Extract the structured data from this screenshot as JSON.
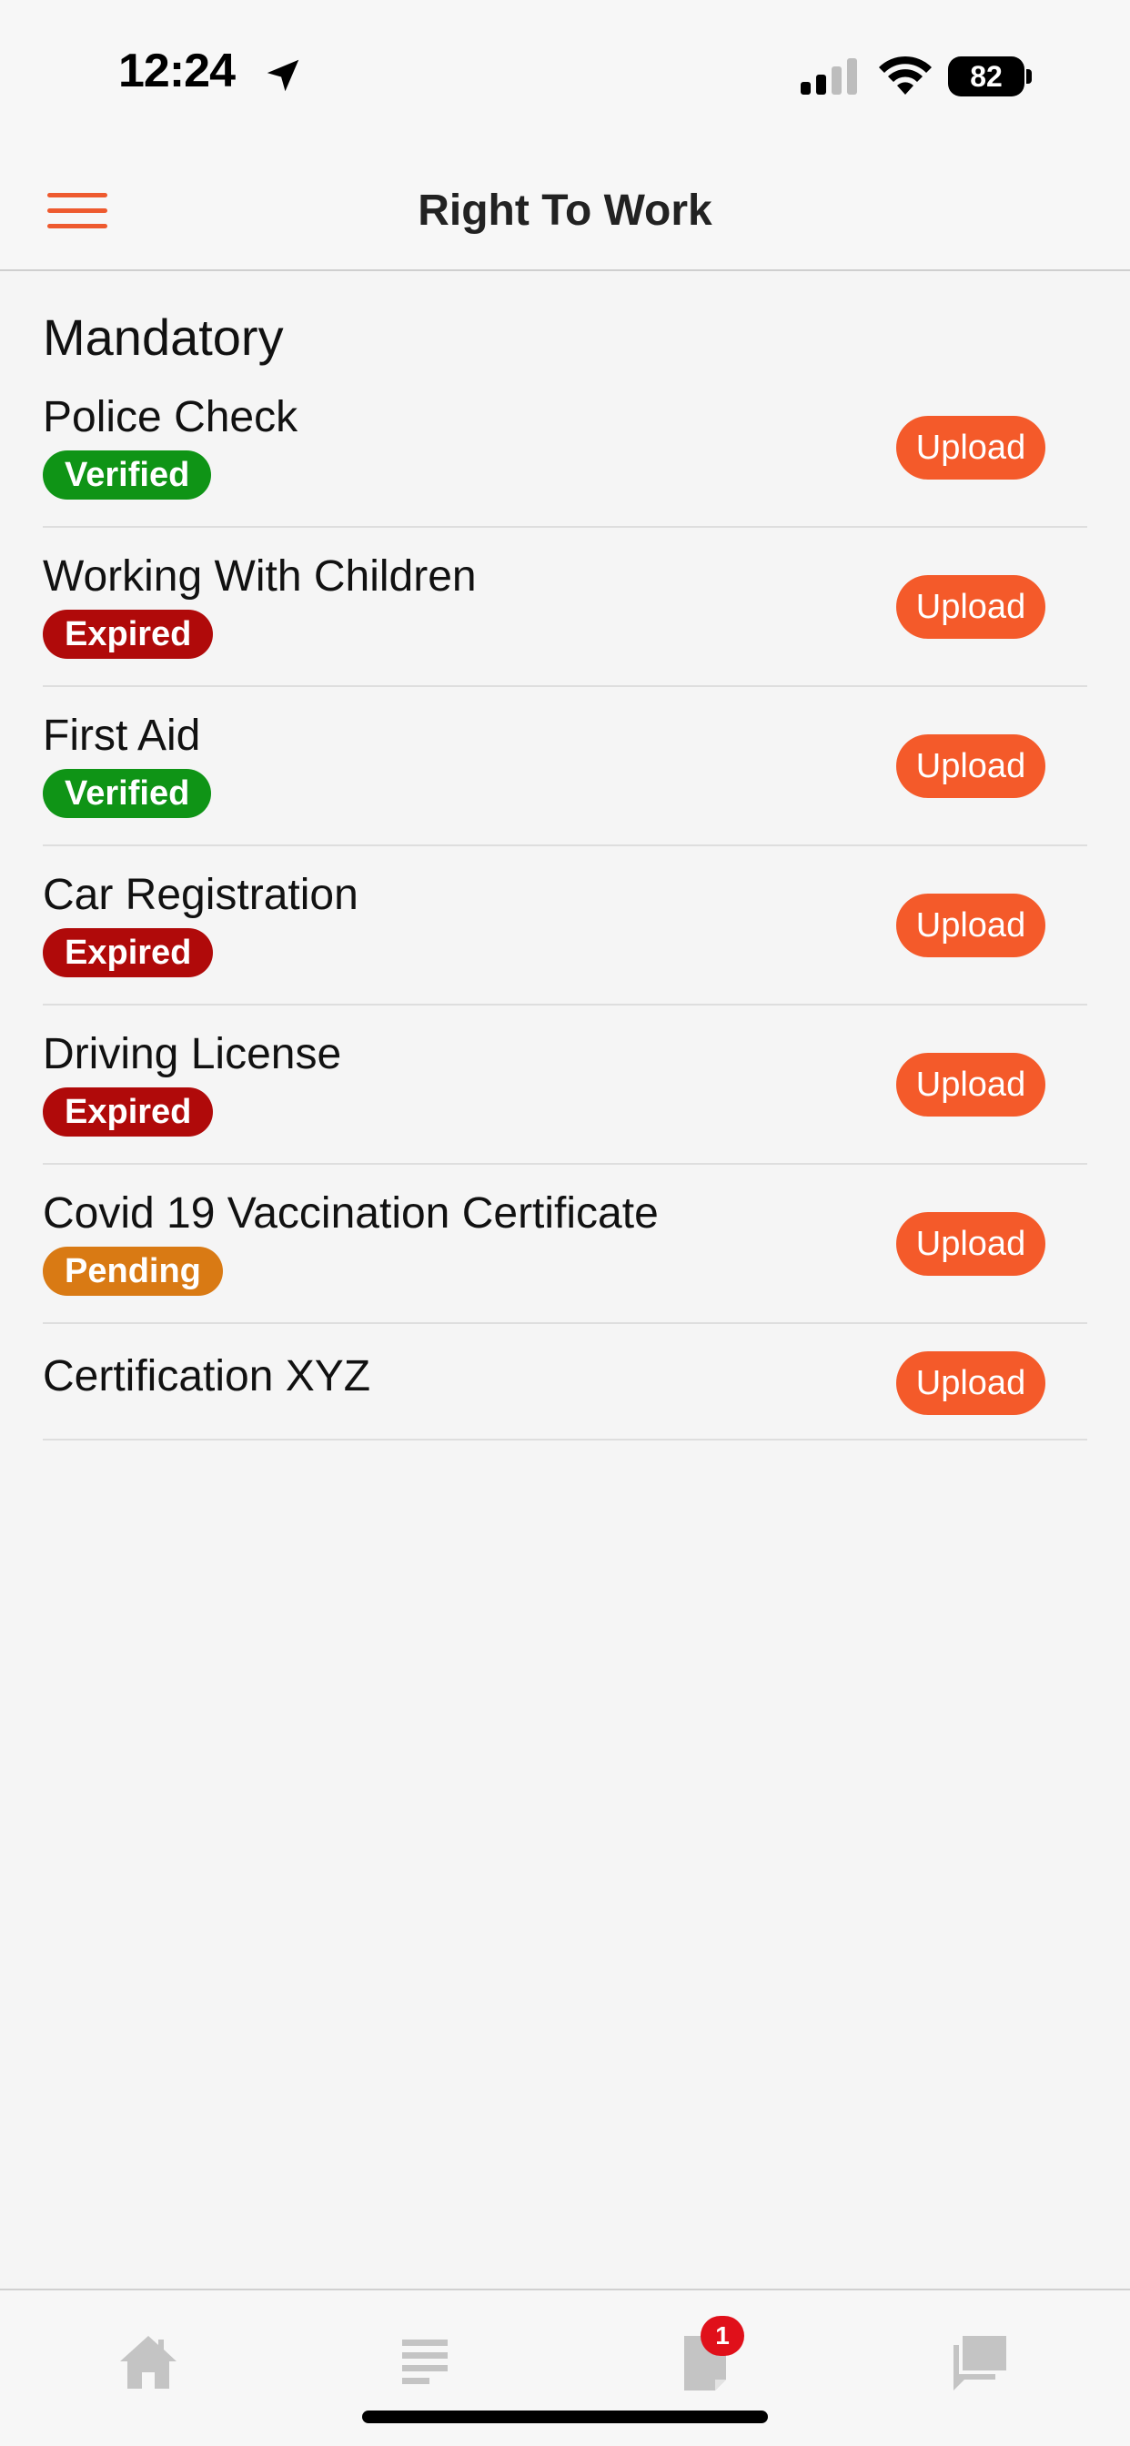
{
  "status_bar": {
    "time": "12:24",
    "battery": "82"
  },
  "header": {
    "title": "Right To Work"
  },
  "section": {
    "title": "Mandatory"
  },
  "documents": [
    {
      "name": "Police Check",
      "status": "Verified",
      "status_color": "#0f9416",
      "action": "Upload"
    },
    {
      "name": "Working With Children",
      "status": "Expired",
      "status_color": "#b00a0a",
      "action": "Upload"
    },
    {
      "name": "First Aid",
      "status": "Verified",
      "status_color": "#0f9416",
      "action": "Upload"
    },
    {
      "name": "Car Registration",
      "status": "Expired",
      "status_color": "#b00a0a",
      "action": "Upload"
    },
    {
      "name": "Driving License",
      "status": "Expired",
      "status_color": "#b00a0a",
      "action": "Upload"
    },
    {
      "name": "Covid 19 Vaccination Certificate",
      "status": "Pending",
      "status_color": "#d97a14",
      "action": "Upload"
    },
    {
      "name": "Certification XYZ",
      "status": null,
      "status_color": null,
      "action": "Upload"
    }
  ],
  "tab_bar": {
    "tabs": [
      {
        "icon": "home-icon"
      },
      {
        "icon": "list-icon"
      },
      {
        "icon": "document-icon",
        "badge": "1"
      },
      {
        "icon": "chat-icon"
      }
    ]
  },
  "colors": {
    "accent": "#f45a2a",
    "verified": "#0f9416",
    "expired": "#b00a0a",
    "pending": "#d97a14",
    "tab_icon": "#c4c4c4"
  }
}
